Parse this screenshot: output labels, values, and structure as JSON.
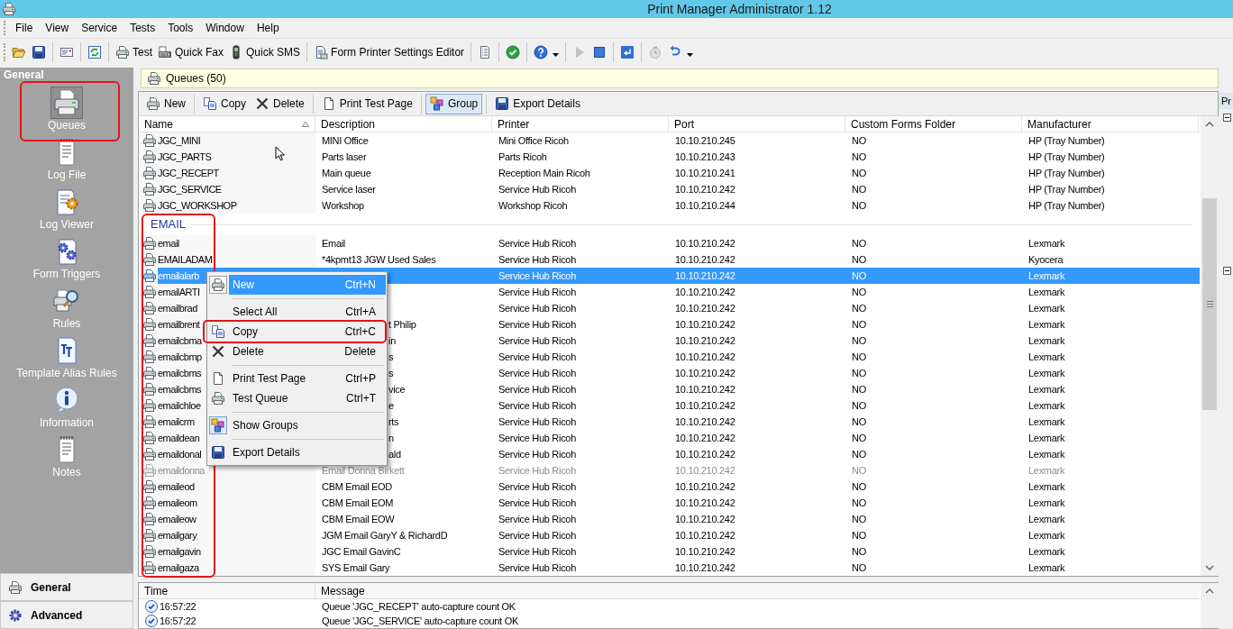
{
  "window": {
    "title": "Print Manager Administrator 1.12"
  },
  "menu_bar": [
    "File",
    "View",
    "Service",
    "Tests",
    "Tools",
    "Window",
    "Help"
  ],
  "toolbar": [
    [
      {
        "disabled": false
      },
      {
        "disabled": false
      }
    ],
    [
      {
        "disabled": false
      }
    ],
    [
      {
        "disabled": false
      }
    ],
    [
      {
        "label": "Test",
        "disabled": false
      },
      {
        "label": "Quick Fax",
        "disabled": false
      },
      {
        "label": "Quick SMS",
        "disabled": false
      }
    ],
    [
      {
        "label": "Form Printer Settings Editor",
        "disabled": false
      }
    ],
    [
      {
        "disabled": false
      }
    ],
    [
      {
        "disabled": false
      }
    ],
    [
      {
        "disabled": false,
        "has_menu": true
      }
    ],
    [
      {
        "disabled": true
      },
      {
        "disabled": false
      }
    ],
    [
      {
        "disabled": false
      }
    ],
    [
      {
        "disabled": true
      },
      {
        "disabled": false,
        "has_menu": true
      }
    ]
  ],
  "sidebar": {
    "title": "General",
    "items": [
      {
        "label": "Queues",
        "selected": true,
        "annotated": true
      },
      {
        "label": "Log File",
        "selected": false,
        "annotated": false
      },
      {
        "label": "Log Viewer",
        "selected": false,
        "annotated": false
      },
      {
        "label": "Form Triggers",
        "selected": false,
        "annotated": false
      },
      {
        "label": "Rules",
        "selected": false,
        "annotated": false
      },
      {
        "label": "Template Alias Rules",
        "selected": false,
        "annotated": false
      },
      {
        "label": "Information",
        "selected": false,
        "annotated": false
      },
      {
        "label": "Notes",
        "selected": false,
        "annotated": false
      }
    ],
    "sections": [
      {
        "label": "General"
      },
      {
        "label": "Advanced"
      }
    ]
  },
  "queues_panel": {
    "title": "Queues (50)",
    "toolbar": [
      [
        {
          "label": "New",
          "pressed": false
        }
      ],
      [
        {
          "label": "Copy",
          "pressed": false
        },
        {
          "label": "Delete",
          "pressed": false
        }
      ],
      [
        {
          "label": "Print Test Page",
          "pressed": false
        }
      ],
      [
        {
          "label": "Group",
          "pressed": true
        }
      ],
      [
        {
          "label": "Export Details",
          "pressed": false
        }
      ]
    ]
  },
  "table": {
    "columns": [
      {
        "label": "Name",
        "sorted": true
      },
      {
        "label": "Description"
      },
      {
        "label": "Printer"
      },
      {
        "label": "Port"
      },
      {
        "label": "Custom Forms Folder"
      },
      {
        "label": "Manufacturer"
      }
    ],
    "groups": [
      {
        "annotated": false,
        "rows": [
          {
            "name": "JGC_MINI",
            "description": "MINI Office",
            "printer": "Mini Office Ricoh",
            "port": "10.10.210.245",
            "custom_forms_folder": "NO",
            "manufacturer": "HP (Tray Number)",
            "selected": false,
            "disabled": false
          },
          {
            "name": "JGC_PARTS",
            "description": "Parts laser",
            "printer": "Parts Ricoh",
            "port": "10.10.210.243",
            "custom_forms_folder": "NO",
            "manufacturer": "HP (Tray Number)",
            "selected": false,
            "disabled": false
          },
          {
            "name": "JGC_RECEPT",
            "description": "Main queue",
            "printer": "Reception Main Ricoh",
            "port": "10.10.210.241",
            "custom_forms_folder": "NO",
            "manufacturer": "HP (Tray Number)",
            "selected": false,
            "disabled": false
          },
          {
            "name": "JGC_SERVICE",
            "description": "Service laser",
            "printer": "Service Hub Ricoh",
            "port": "10.10.210.242",
            "custom_forms_folder": "NO",
            "manufacturer": "HP (Tray Number)",
            "selected": false,
            "disabled": false
          },
          {
            "name": "JGC_WORKSHOP",
            "description": "Workshop",
            "printer": "Workshop Ricoh",
            "port": "10.10.210.244",
            "custom_forms_folder": "NO",
            "manufacturer": "HP (Tray Number)",
            "selected": false,
            "disabled": false
          }
        ]
      },
      {
        "title": "EMAIL",
        "annotated": true,
        "rows": [
          {
            "name": "email",
            "description": "Email",
            "printer": "Service Hub Ricoh",
            "port": "10.10.210.242",
            "custom_forms_folder": "NO",
            "manufacturer": "Lexmark",
            "selected": false,
            "disabled": false
          },
          {
            "name": "EMAILADAM",
            "description": "*4kpmt13 JGW Used Sales",
            "printer": "Service Hub Ricoh",
            "port": "10.10.210.242",
            "custom_forms_folder": "NO",
            "manufacturer": "Kyocera",
            "selected": false,
            "disabled": false
          },
          {
            "name": "emailalarb",
            "printer": "Service Hub Ricoh",
            "port": "10.10.210.242",
            "custom_forms_folder": "NO",
            "manufacturer": "Lexmark",
            "selected": true,
            "disabled": false
          },
          {
            "name": "emailARTI",
            "printer": "Service Hub Ricoh",
            "port": "10.10.210.242",
            "custom_forms_folder": "NO",
            "manufacturer": "Lexmark",
            "selected": false,
            "disabled": false
          },
          {
            "name": "emailbrad",
            "printer": "Service Hub Ricoh",
            "port": "10.10.210.242",
            "custom_forms_folder": "NO",
            "manufacturer": "Lexmark",
            "selected": false,
            "disabled": false
          },
          {
            "name": "emailbrent",
            "description": "t Philip",
            "printer": "Service Hub Ricoh",
            "port": "10.10.210.242",
            "custom_forms_folder": "NO",
            "manufacturer": "Lexmark",
            "selected": false,
            "disabled": false
          },
          {
            "name": "emailcbma",
            "description": "in",
            "printer": "Service Hub Ricoh",
            "port": "10.10.210.242",
            "custom_forms_folder": "NO",
            "manufacturer": "Lexmark",
            "selected": false,
            "disabled": false
          },
          {
            "name": "emailcbmp",
            "description": "s",
            "printer": "Service Hub Ricoh",
            "port": "10.10.210.242",
            "custom_forms_folder": "NO",
            "manufacturer": "Lexmark",
            "selected": false,
            "disabled": false
          },
          {
            "name": "emailcbms",
            "description": "s",
            "printer": "Service Hub Ricoh",
            "port": "10.10.210.242",
            "custom_forms_folder": "NO",
            "manufacturer": "Lexmark",
            "selected": false,
            "disabled": false
          },
          {
            "name": "emailcbms",
            "description": "vice",
            "printer": "Service Hub Ricoh",
            "port": "10.10.210.242",
            "custom_forms_folder": "NO",
            "manufacturer": "Lexmark",
            "selected": false,
            "disabled": false
          },
          {
            "name": "emailchloe",
            "description": "e",
            "printer": "Service Hub Ricoh",
            "port": "10.10.210.242",
            "custom_forms_folder": "NO",
            "manufacturer": "Lexmark",
            "selected": false,
            "disabled": false
          },
          {
            "name": "emailcrm",
            "description": "rts",
            "printer": "Service Hub Ricoh",
            "port": "10.10.210.242",
            "custom_forms_folder": "NO",
            "manufacturer": "Lexmark",
            "selected": false,
            "disabled": false
          },
          {
            "name": "emaildean",
            "description": "n",
            "printer": "Service Hub Ricoh",
            "port": "10.10.210.242",
            "custom_forms_folder": "NO",
            "manufacturer": "Lexmark",
            "selected": false,
            "disabled": false
          },
          {
            "name": "emaildonal",
            "description": "ald",
            "printer": "Service Hub Ricoh",
            "port": "10.10.210.242",
            "custom_forms_folder": "NO",
            "manufacturer": "Lexmark",
            "selected": false,
            "disabled": false
          },
          {
            "name": "emaildonna",
            "description": "Email Donna Birkett",
            "printer": "Service Hub Ricoh",
            "port": "10.10.210.242",
            "custom_forms_folder": "NO",
            "manufacturer": "Lexmark",
            "selected": false,
            "disabled": true
          },
          {
            "name": "emaileod",
            "description": "CBM Email EOD",
            "printer": "Service Hub Ricoh",
            "port": "10.10.210.242",
            "custom_forms_folder": "NO",
            "manufacturer": "Lexmark",
            "selected": false,
            "disabled": false
          },
          {
            "name": "emaileom",
            "description": "CBM Email EOM",
            "printer": "Service Hub Ricoh",
            "port": "10.10.210.242",
            "custom_forms_folder": "NO",
            "manufacturer": "Lexmark",
            "selected": false,
            "disabled": false
          },
          {
            "name": "emaileow",
            "description": "CBM Email EOW",
            "printer": "Service Hub Ricoh",
            "port": "10.10.210.242",
            "custom_forms_folder": "NO",
            "manufacturer": "Lexmark",
            "selected": false,
            "disabled": false
          },
          {
            "name": "emailgary",
            "description": "JGM Email GaryY & RichardD",
            "printer": "Service Hub Ricoh",
            "port": "10.10.210.242",
            "custom_forms_folder": "NO",
            "manufacturer": "Lexmark",
            "selected": false,
            "disabled": false
          },
          {
            "name": "emailgavin",
            "description": "JGC Email GavinC",
            "printer": "Service Hub Ricoh",
            "port": "10.10.210.242",
            "custom_forms_folder": "NO",
            "manufacturer": "Lexmark",
            "selected": false,
            "disabled": false
          },
          {
            "name": "emailgaza",
            "description": "SYS Email Gary",
            "printer": "Service Hub Ricoh",
            "port": "10.10.210.242",
            "custom_forms_folder": "NO",
            "manufacturer": "Lexmark",
            "selected": false,
            "disabled": false
          }
        ]
      }
    ]
  },
  "context_menu": {
    "items": [
      {
        "kind": "item",
        "label": "New",
        "shortcut": "Ctrl+N",
        "selected": true,
        "checked": false,
        "annotated": false
      },
      {
        "kind": "separator"
      },
      {
        "kind": "item",
        "label": "Select All",
        "shortcut": "Ctrl+A",
        "selected": false,
        "checked": false,
        "annotated": false
      },
      {
        "kind": "item",
        "label": "Copy",
        "shortcut": "Ctrl+C",
        "selected": false,
        "checked": false,
        "annotated": true
      },
      {
        "kind": "item",
        "label": "Delete",
        "shortcut": "Delete",
        "selected": false,
        "checked": false,
        "annotated": false
      },
      {
        "kind": "separator"
      },
      {
        "kind": "item",
        "label": "Print Test Page",
        "shortcut": "Ctrl+P",
        "selected": false,
        "checked": false,
        "annotated": false
      },
      {
        "kind": "item",
        "label": "Test Queue",
        "shortcut": "Ctrl+T",
        "selected": false,
        "checked": false,
        "annotated": false
      },
      {
        "kind": "separator"
      },
      {
        "kind": "item",
        "label": "Show Groups",
        "selected": false,
        "checked": true,
        "annotated": false
      },
      {
        "kind": "separator"
      },
      {
        "kind": "item",
        "label": "Export Details",
        "selected": false,
        "checked": false,
        "annotated": false
      }
    ]
  },
  "log": {
    "columns": [
      "Time",
      "Message"
    ],
    "rows": [
      {
        "time": "16:57:22",
        "message": "Queue 'JGC_RECEPT' auto-capture count OK"
      },
      {
        "time": "16:57:22",
        "message": "Queue 'JGC_SERVICE' auto-capture count OK"
      }
    ]
  },
  "side_panel": {
    "title": "Pr"
  }
}
